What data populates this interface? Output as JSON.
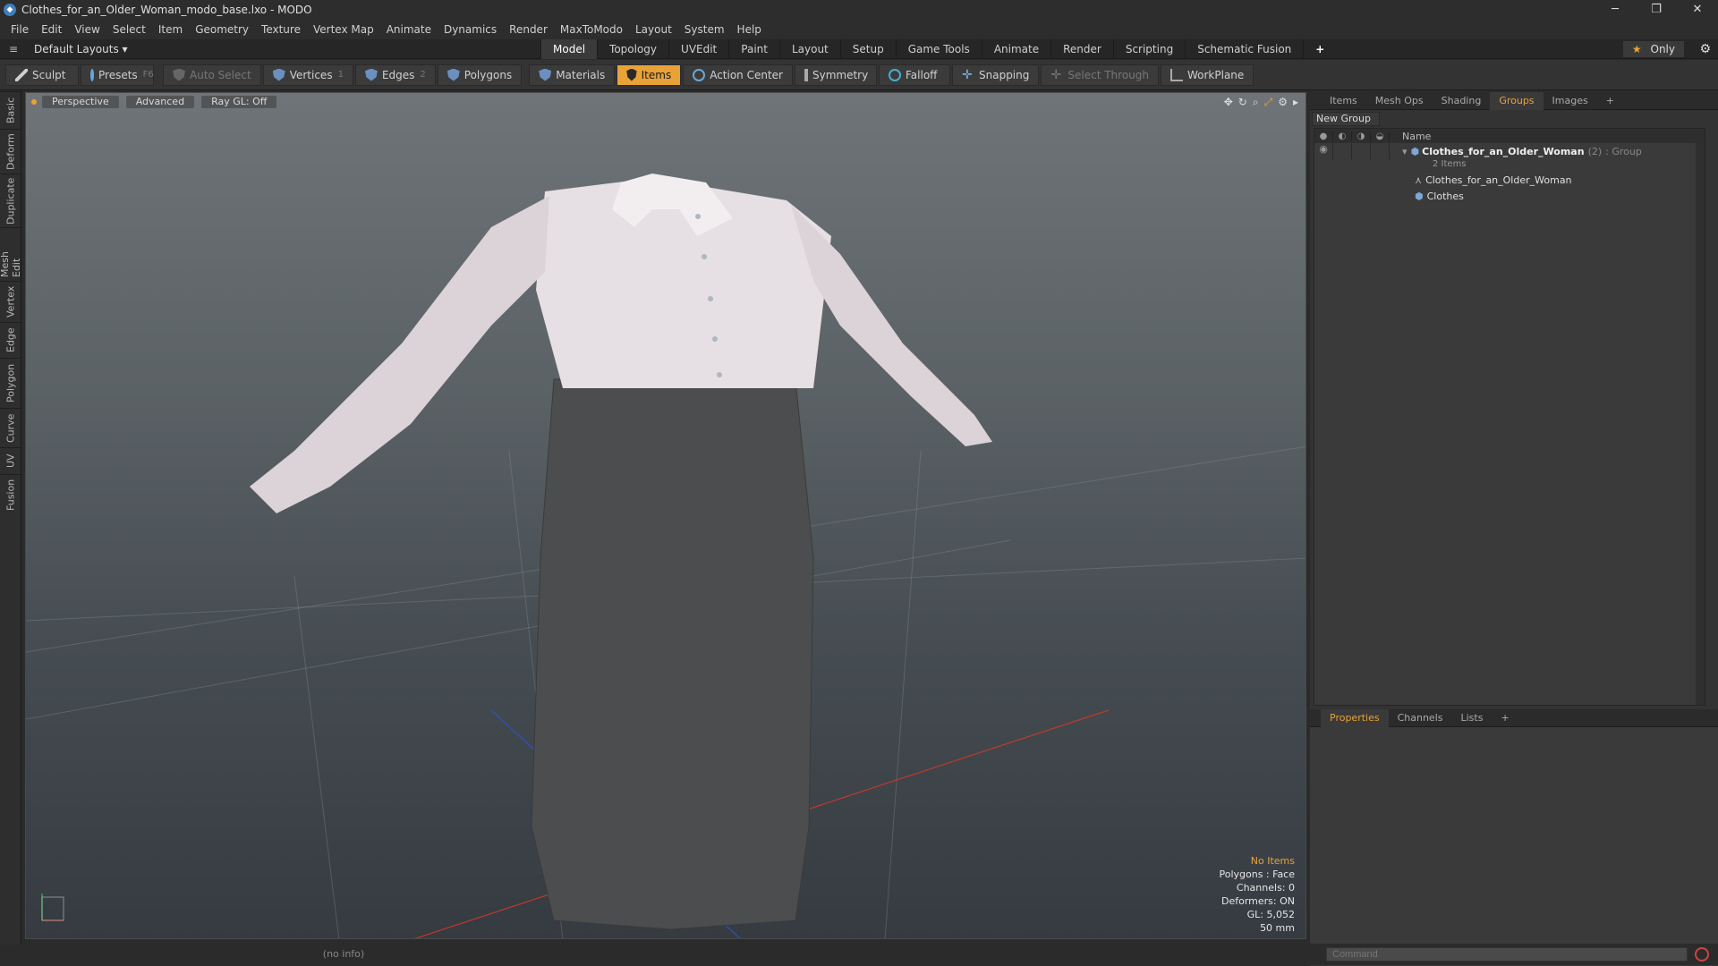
{
  "window": {
    "title": "Clothes_for_an_Older_Woman_modo_base.lxo - MODO",
    "controls": [
      "─",
      "❐",
      "✕"
    ]
  },
  "menubar": [
    "File",
    "Edit",
    "View",
    "Select",
    "Item",
    "Geometry",
    "Texture",
    "Vertex Map",
    "Animate",
    "Dynamics",
    "Render",
    "MaxToModo",
    "Layout",
    "System",
    "Help"
  ],
  "layoutbar": {
    "layout_dropdown": "Default Layouts ▾",
    "tabs": [
      "Model",
      "Topology",
      "UVEdit",
      "Paint",
      "Layout",
      "Setup",
      "Game Tools",
      "Animate",
      "Render",
      "Scripting",
      "Schematic Fusion",
      "+"
    ],
    "active_tab": "Model",
    "only_label": "Only"
  },
  "toolbar": {
    "sculpt": "Sculpt",
    "presets": "Presets",
    "presets_key": "F6",
    "auto_select": "Auto Select",
    "vertices": "Vertices",
    "vertices_key": "1",
    "edges": "Edges",
    "edges_key": "2",
    "polygons": "Polygons",
    "materials": "Materials",
    "items": "Items",
    "action_center": "Action Center",
    "symmetry": "Symmetry",
    "falloff": "Falloff",
    "snapping": "Snapping",
    "select_through": "Select Through",
    "workplane": "WorkPlane"
  },
  "left_tabs": [
    "Basic",
    "Deform",
    "Duplicate",
    "Mesh Edit",
    "Vertex",
    "Edge",
    "Polygon",
    "Curve",
    "UV",
    "Fusion"
  ],
  "viewport": {
    "view": "Perspective",
    "shading": "Advanced",
    "raygl": "Ray GL: Off",
    "info": {
      "selection": "No Items",
      "polygons": "Polygons : Face",
      "channels": "Channels: 0",
      "deformers": "Deformers: ON",
      "gl": "GL: 5,052",
      "scale": "50 mm"
    }
  },
  "statusbar": "(no info)",
  "right_panel": {
    "tabs": [
      "Items",
      "Mesh Ops",
      "Shading",
      "Groups",
      "Images",
      "+"
    ],
    "active_tab": "Groups",
    "new_group": "New Group",
    "table_header": "Name",
    "group": {
      "name": "Clothes_for_an_Older_Woman",
      "count": "(2)",
      "type": ": Group",
      "items_label": "2 Items",
      "children": [
        "Clothes_for_an_Older_Woman",
        "Clothes"
      ]
    },
    "bottom_tabs": [
      "Properties",
      "Channels",
      "Lists",
      "+"
    ],
    "bottom_active": "Properties"
  },
  "command": {
    "placeholder": "Command"
  },
  "colors": {
    "accent": "#e9a237",
    "x_axis": "#c0392b",
    "z_axis": "#3050c0"
  }
}
